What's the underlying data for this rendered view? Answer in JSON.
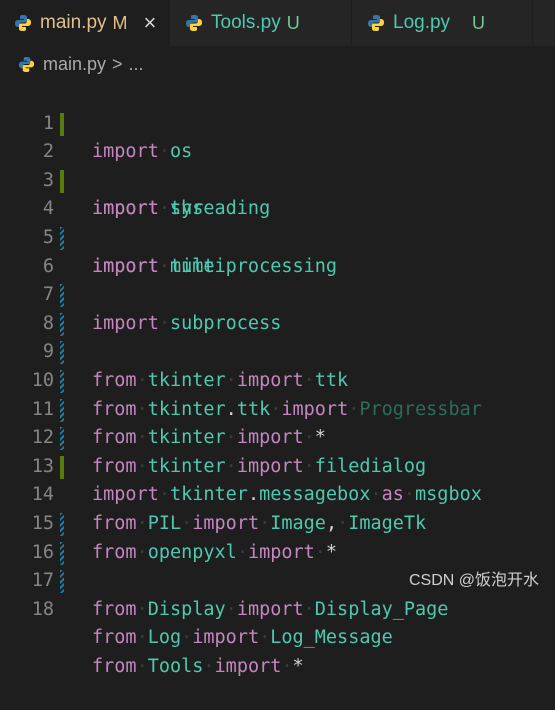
{
  "tabs": [
    {
      "label": "main.py",
      "status": "M",
      "active": true
    },
    {
      "label": "Tools.py",
      "status": "U",
      "active": false
    },
    {
      "label": "Log.py",
      "status": "U",
      "active": false
    }
  ],
  "breadcrumb": {
    "file": "main.py",
    "separator": ">",
    "rest": "..."
  },
  "lines": [
    {
      "n": "1",
      "gutter": "none"
    },
    {
      "n": "2",
      "gutter": "added"
    },
    {
      "n": "3",
      "gutter": "none"
    },
    {
      "n": "4",
      "gutter": "added"
    },
    {
      "n": "5",
      "gutter": "none"
    },
    {
      "n": "6",
      "gutter": "modified"
    },
    {
      "n": "7",
      "gutter": "none"
    },
    {
      "n": "8",
      "gutter": "modified"
    },
    {
      "n": "9",
      "gutter": "modified"
    },
    {
      "n": "10",
      "gutter": "modified"
    },
    {
      "n": "11",
      "gutter": "modified"
    },
    {
      "n": "12",
      "gutter": "modified"
    },
    {
      "n": "13",
      "gutter": "modified"
    },
    {
      "n": "14",
      "gutter": "added"
    },
    {
      "n": "15",
      "gutter": "none"
    },
    {
      "n": "16",
      "gutter": "modified"
    },
    {
      "n": "17",
      "gutter": "modified"
    },
    {
      "n": "18",
      "gutter": "modified"
    }
  ],
  "code": {
    "l1": [
      "import",
      "os"
    ],
    "l2": [
      "import",
      "sys"
    ],
    "l3": [
      "import",
      "threading"
    ],
    "l4": [
      "import",
      "time"
    ],
    "l5": [
      "import",
      "multiprocessing"
    ],
    "l6": [
      "import",
      "subprocess"
    ],
    "l8": [
      "from",
      "tkinter",
      "import",
      "ttk"
    ],
    "l9": [
      "from",
      "tkinter",
      ".",
      "ttk",
      "import",
      "Progressbar"
    ],
    "l10": [
      "from",
      "tkinter",
      "import",
      "*"
    ],
    "l11": [
      "from",
      "tkinter",
      "import",
      "filedialog"
    ],
    "l12": [
      "import",
      "tkinter",
      ".",
      "messagebox",
      "as",
      "msgbox"
    ],
    "l13": [
      "from",
      "PIL",
      "import",
      "Image",
      ",",
      "ImageTk"
    ],
    "l14": [
      "from",
      "openpyxl",
      "import",
      "*"
    ],
    "l16": [
      "from",
      "Display",
      "import",
      "Display_Page"
    ],
    "l17": [
      "from",
      "Log",
      "import",
      "Log_Message"
    ],
    "l18": [
      "from",
      "Tools",
      "import",
      "*"
    ]
  },
  "watermark": "CSDN @饭泡开水",
  "icons": {
    "tab_file_icon": "python-icon",
    "tab_close_icon": "close-icon"
  },
  "colors": {
    "modified_tab": "#e2c08d",
    "untracked_tab": "#4ec9b0",
    "added_gutter": "#587c0c",
    "modified_gutter": "#1b81a8",
    "keyword": "#c586c0",
    "module": "#4ec9b0"
  }
}
